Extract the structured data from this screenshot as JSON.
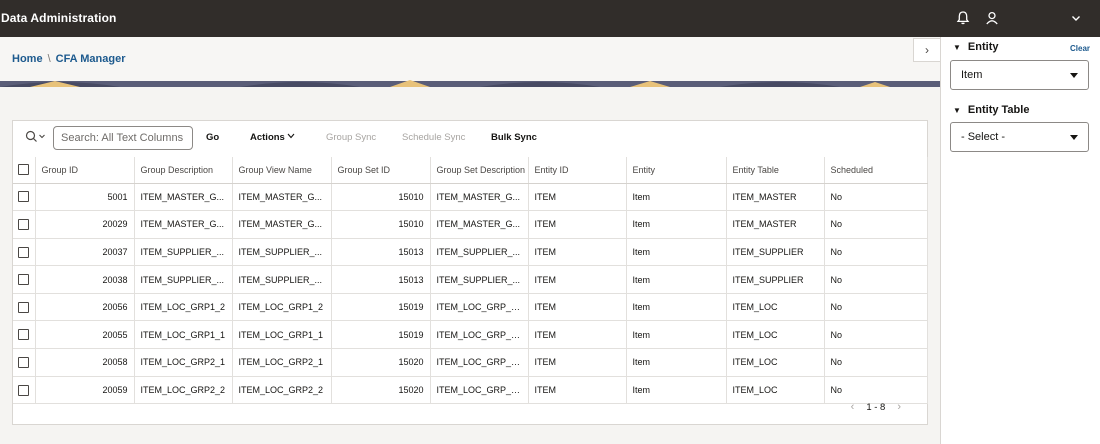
{
  "header": {
    "title": "Data Administration",
    "icons": [
      "bell-icon",
      "user-icon",
      "chevron-down-icon"
    ]
  },
  "breadcrumb": {
    "home": "Home",
    "separator": "\\",
    "current": "CFA Manager"
  },
  "toolbar": {
    "search_placeholder": "Search: All Text Columns",
    "go": "Go",
    "actions": "Actions",
    "group_sync": "Group Sync",
    "schedule_sync": "Schedule Sync",
    "bulk_sync": "Bulk Sync"
  },
  "table": {
    "columns": [
      "Group ID",
      "Group Description",
      "Group View Name",
      "Group Set ID",
      "Group Set Description",
      "Entity ID",
      "Entity",
      "Entity Table",
      "Scheduled"
    ],
    "rows": [
      [
        "5001",
        "ITEM_MASTER_G...",
        "ITEM_MASTER_G...",
        "15010",
        "ITEM_MASTER_G...",
        "ITEM",
        "Item",
        "ITEM_MASTER",
        "No"
      ],
      [
        "20029",
        "ITEM_MASTER_G...",
        "ITEM_MASTER_G...",
        "15010",
        "ITEM_MASTER_G...",
        "ITEM",
        "Item",
        "ITEM_MASTER",
        "No"
      ],
      [
        "20037",
        "ITEM_SUPPLIER_...",
        "ITEM_SUPPLIER_...",
        "15013",
        "ITEM_SUPPLIER_...",
        "ITEM",
        "Item",
        "ITEM_SUPPLIER",
        "No"
      ],
      [
        "20038",
        "ITEM_SUPPLIER_...",
        "ITEM_SUPPLIER_...",
        "15013",
        "ITEM_SUPPLIER_...",
        "ITEM",
        "Item",
        "ITEM_SUPPLIER",
        "No"
      ],
      [
        "20056",
        "ITEM_LOC_GRP1_2",
        "ITEM_LOC_GRP1_2",
        "15019",
        "ITEM_LOC_GRP_S...",
        "ITEM",
        "Item",
        "ITEM_LOC",
        "No"
      ],
      [
        "20055",
        "ITEM_LOC_GRP1_1",
        "ITEM_LOC_GRP1_1",
        "15019",
        "ITEM_LOC_GRP_S...",
        "ITEM",
        "Item",
        "ITEM_LOC",
        "No"
      ],
      [
        "20058",
        "ITEM_LOC_GRP2_1",
        "ITEM_LOC_GRP2_1",
        "15020",
        "ITEM_LOC_GRP_S...",
        "ITEM",
        "Item",
        "ITEM_LOC",
        "No"
      ],
      [
        "20059",
        "ITEM_LOC_GRP2_2",
        "ITEM_LOC_GRP2_2",
        "15020",
        "ITEM_LOC_GRP_S...",
        "ITEM",
        "Item",
        "ITEM_LOC",
        "No"
      ]
    ]
  },
  "pager": {
    "range": "1 - 8",
    "prev_icon": "chevron-left-icon",
    "next_icon": "chevron-right-icon"
  },
  "drawer": {
    "toggle_icon": "chevron-right-icon",
    "entity_label": "Entity",
    "clear": "Clear",
    "entity_value": "Item",
    "entity_table_label": "Entity Table",
    "entity_table_value": "- Select -"
  },
  "colors": {
    "header_bg": "#312d2a",
    "link": "#1d5a8e",
    "banner_band": "#5a5d78"
  }
}
